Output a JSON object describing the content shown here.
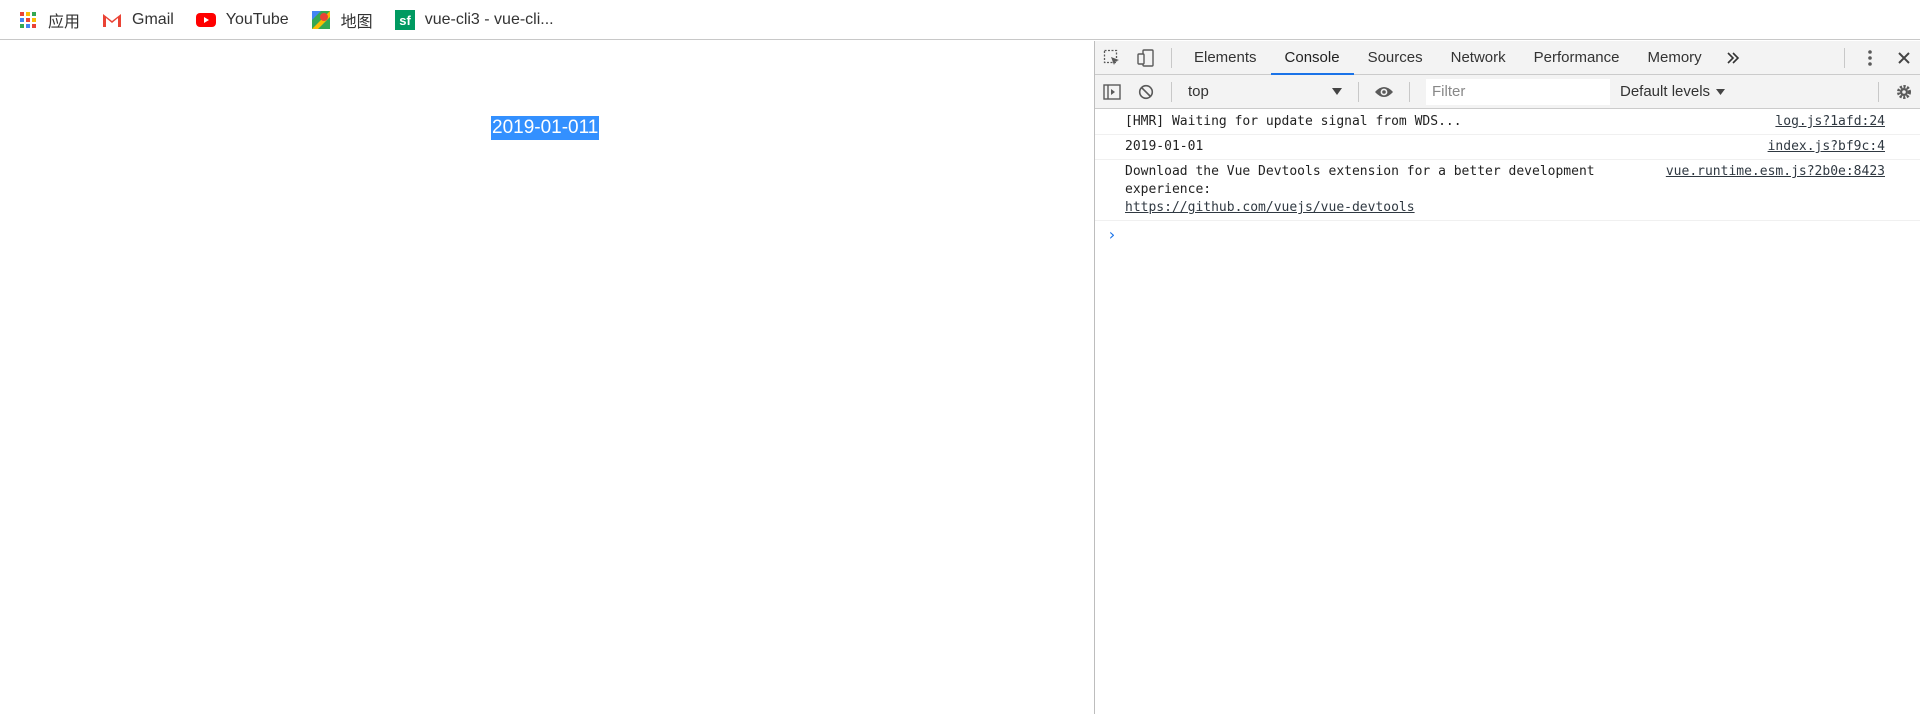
{
  "bookmarks": [
    {
      "label": "应用",
      "icon": "apps-grid-icon"
    },
    {
      "label": "Gmail",
      "icon": "gmail-icon"
    },
    {
      "label": "YouTube",
      "icon": "youtube-icon"
    },
    {
      "label": "地图",
      "icon": "maps-icon"
    },
    {
      "label": "vue-cli3 - vue-cli...",
      "icon": "segmentfault-icon"
    }
  ],
  "page": {
    "selected_text": "2019-01-011"
  },
  "devtools": {
    "tabs": [
      "Elements",
      "Console",
      "Sources",
      "Network",
      "Performance",
      "Memory"
    ],
    "active_tab": "Console",
    "context": "top",
    "filter_placeholder": "Filter",
    "levels": "Default levels",
    "messages": [
      {
        "text": "[HMR] Waiting for update signal from WDS...",
        "source": "log.js?1afd:24"
      },
      {
        "text": "2019-01-01",
        "source": "index.js?bf9c:4"
      },
      {
        "text": "Download the Vue Devtools extension for a better development experience:",
        "link": "https://github.com/vuejs/vue-devtools",
        "source": "vue.runtime.esm.js?2b0e:8423"
      }
    ]
  }
}
